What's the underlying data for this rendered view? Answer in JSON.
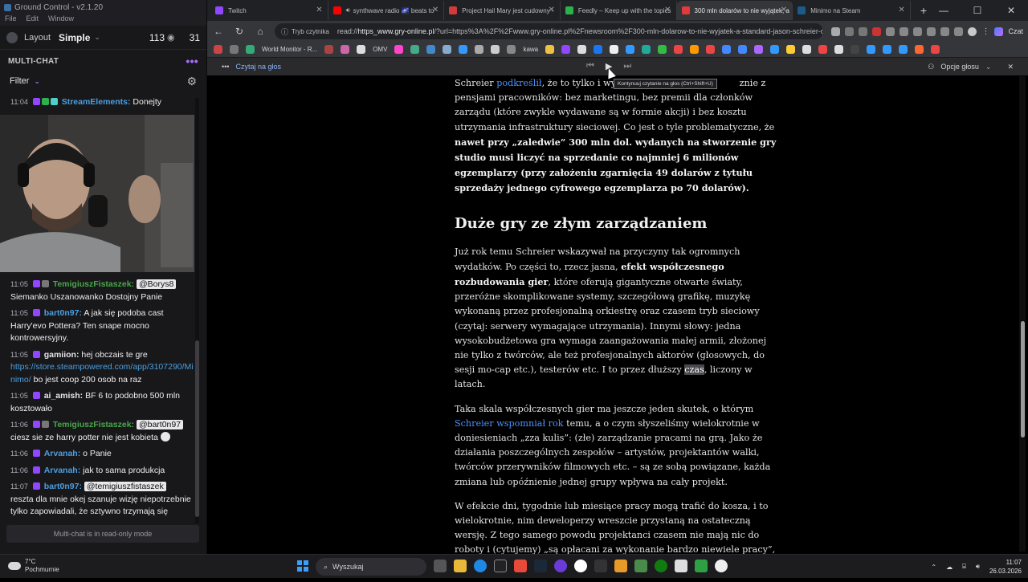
{
  "gc": {
    "title": "Ground Control - v2.1.20",
    "menu": [
      "File",
      "Edit",
      "Window"
    ],
    "layout_label": "Layout",
    "layout_value": "Simple",
    "viewers": "113",
    "viewers2": "31",
    "multichat_label": "MULTI-CHAT",
    "filter_label": "Filter",
    "readonly_note": "Multi-chat is in read-only mode",
    "messages": [
      {
        "time": "11:04",
        "user": "StreamElements:",
        "user_color": "#4a9fe0",
        "text": "Donejty"
      },
      {
        "time": "11:05",
        "user": "TemigiuszFistaszek:",
        "user_color": "#4aa64a",
        "mention": "@Borys8",
        "text": "Siemanko Uszanowanko Dostojny Panie"
      },
      {
        "time": "11:05",
        "user": "bart0n97:",
        "user_color": "#4a9fe0",
        "text": "A jak się podoba cast Harry'evo Pottera? Ten snape mocno kontrowersyjny."
      },
      {
        "time": "11:05",
        "user": "gamiion:",
        "user_color": "#e6e6ea",
        "text": "hej obczais te gre",
        "link": "https://store.steampowered.com/app/3107290/Mi nimo/",
        "text2": "bo jest coop 200 osob na raz"
      },
      {
        "time": "11:05",
        "user": "ai_amish:",
        "user_color": "#e6e6ea",
        "text": "BF 6 to podobno 500 mln kosztowało"
      },
      {
        "time": "11:06",
        "user": "TemigiuszFistaszek:",
        "user_color": "#4aa64a",
        "mention": "@bart0n97",
        "text": "ciesz sie ze harry potter nie jest kobieta"
      },
      {
        "time": "11:06",
        "user": "Arvanah:",
        "user_color": "#4a9fe0",
        "text": "o Panie"
      },
      {
        "time": "11:06",
        "user": "Arvanah:",
        "user_color": "#4a9fe0",
        "text": "jak to sama produkcja"
      },
      {
        "time": "11:07",
        "user": "bart0n97:",
        "user_color": "#4a9fe0",
        "mention": "@temigiuszfistaszek",
        "text": "reszta dla mnie okej szanuje wizję niepotrzebnie tylko zapowiadali, że sztywno trzymają się książek."
      }
    ]
  },
  "browser": {
    "tabs": [
      {
        "label": "Twitch",
        "color": "#9146ff",
        "active": false,
        "w": 148
      },
      {
        "label": "synthwave radio 🌌 beats to",
        "color": "#ff0000",
        "active": false,
        "w": 146
      },
      {
        "label": "Project Hail Mary jest cudowny -",
        "color": "#d23b3b",
        "active": false,
        "w": 146
      },
      {
        "label": "Feedly – Keep up with the topics",
        "color": "#2bb24c",
        "active": false,
        "w": 146
      },
      {
        "label": "300 mln dolarów to nie wyjątek, a",
        "color": "#e03a3a",
        "active": true,
        "w": 146
      },
      {
        "label": "Minimo na Steam",
        "color": "#1b2838",
        "active": false,
        "w": 148
      }
    ],
    "address": {
      "mode": "Tryb czytnika",
      "prefix": "read://",
      "host": "https_www.gry-online.pl",
      "rest": "/?url=https%3A%2F%2Fwww.gry-online.pl%2Fnewsroom%2F300-mln-dolarow-to-nie-wyjatek-a-standard-jason-schreier-o-a..."
    },
    "bookmarks": [
      "World Monitor - R...",
      "OMV",
      "kawa"
    ],
    "readbar": {
      "read_aloud": "Czytaj na głos",
      "voice_options": "Opcje głosu"
    },
    "tooltip": "Kontynuuj czytanie na głos (Ctrl+Shift+U)",
    "profile_label": "Czat"
  },
  "article": {
    "p1_a": "Schreier ",
    "p1_link": "podkreślił",
    "p1_b": ", że to tylko i wył",
    "p1_c": "znie z pensjami pracowników: bez marketingu, bez premii dla członków zarządu (które zwykle wydawane są w formie akcji) i bez kosztu utrzymania infrastruktury sieciowej. Co jest o tyle problematyczne, że ",
    "p1_bold": "nawet przy „zaledwie” 300 mln dol. wydanych na stworzenie gry studio musi liczyć na sprzedanie co najmniej 6 milionów egzemplarzy (przy założeniu zgarnięcia 49 dolarów z tytułu sprzedaży jednego cyfrowego egzemplarza po 70 dolarów).",
    "heading": "Duże gry ze złym zarządzaniem",
    "p2_a": "Już rok temu Schreier wskazywał na przyczyny tak ogromnych wydatków. Po części to, rzecz jasna, ",
    "p2_bold": "efekt współczesnego rozbudowania gier",
    "p2_b": ", które oferują gigantyczne otwarte światy, przeróżne skomplikowane systemy, szczegółową grafikę, muzykę wykonaną przez profesjonalną orkiestrę oraz czasem tryb sieciowy (czytaj: serwery wymagające utrzymania). Innymi słowy: jedna wysokobudżetowa gra wymaga zaangażowania małej armii, złożonej nie tylko z twórców, ale też profesjonalnych aktorów (głosowych, do sesji mo-cap etc.), testerów etc. I to przez dłuższy ",
    "p2_hl": "czas",
    "p2_c": ", liczony w latach.",
    "p3_a": "Taka skala współczesnych gier ma jeszcze jeden skutek, o którym ",
    "p3_link": "Schreier wspomniał rok",
    "p3_b": " temu, a o czym słyszeliśmy wielokrotnie w doniesieniach „zza kulis”: (złe) zarządzanie pracami na grą. Jako że działania poszczególnych zespołów – artystów, projektantów walki, twórców przerywników filmowych etc. – są ze sobą powiązane, każda zmiana lub opóźnienie jednej grupy wpływa na cały projekt.",
    "p4": "W efekcie dni, tygodnie lub miesiące pracy mogą trafić do kosza, i to wielokrotnie, nim deweloperzy wreszcie przystaną na ostateczną wersję. Z tego samego powodu projektanci czasem nie mają nic do roboty i (cytujemy) „są opłacani za wykonanie bardzo niewiele pracy”, gdy czekają na – na przykład – zatwierdzenie lokacji lub postaci."
  },
  "taskbar": {
    "weather_temp": "7°C",
    "weather_desc": "Pochmurnie",
    "search_placeholder": "Wyszukaj",
    "time": "11:07",
    "date": "26.03.2026"
  },
  "colors": {
    "accent": "#a970ff",
    "link": "#4d90ff",
    "bg": "#000000"
  }
}
